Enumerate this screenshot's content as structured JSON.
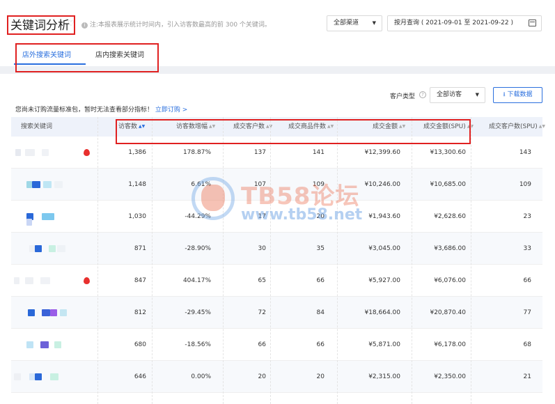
{
  "header": {
    "title": "关键词分析",
    "heart_icon": "heart-outline-icon",
    "note_icon": "info-icon",
    "note": "注:本报表展示统计时间内，引入访客数最高的前 300 个关键词。",
    "channel": "全部渠道",
    "date_mode": "按月查询",
    "date_range": "( 2021-09-01 至 2021-09-22 )",
    "calendar_icon": "calendar-icon"
  },
  "tabs": [
    {
      "label": "店外搜索关键词",
      "active": true
    },
    {
      "label": "店内搜索关键词",
      "active": false
    }
  ],
  "toolbar": {
    "customer_type_label": "客户类型",
    "help_icon": "question-icon",
    "customer_type_value": "全部访客",
    "download_label": "下载数据",
    "download_icon": "download-icon"
  },
  "notice": {
    "text": "您尚未订购流量标准包，暂时无法查看部分指标！",
    "link": "立即订购 >"
  },
  "table": {
    "columns": [
      "搜索关键词",
      "访客数",
      "访客数增幅",
      "成交客户数",
      "成交商品件数",
      "成交金额",
      "成交金额(SPU)",
      "成交客户数(SPU)"
    ],
    "rows": [
      [
        "",
        "1,386",
        "178.87%",
        "137",
        "141",
        "¥12,399.60",
        "¥13,300.60",
        "143"
      ],
      [
        "",
        "1,148",
        "6.61%",
        "107",
        "109",
        "¥10,246.00",
        "¥10,685.00",
        "109"
      ],
      [
        "",
        "1,030",
        "-44.29%",
        "17",
        "20",
        "¥1,943.60",
        "¥2,628.60",
        "23"
      ],
      [
        "",
        "871",
        "-28.90%",
        "30",
        "35",
        "¥3,045.00",
        "¥3,686.00",
        "33"
      ],
      [
        "",
        "847",
        "404.17%",
        "65",
        "66",
        "¥5,927.00",
        "¥6,076.00",
        "66"
      ],
      [
        "",
        "812",
        "-29.45%",
        "72",
        "84",
        "¥18,664.00",
        "¥20,870.40",
        "77"
      ],
      [
        "",
        "680",
        "-18.56%",
        "66",
        "66",
        "¥5,871.00",
        "¥6,178.00",
        "68"
      ],
      [
        "",
        "646",
        "0.00%",
        "20",
        "20",
        "¥2,315.00",
        "¥2,350.00",
        "21"
      ]
    ]
  },
  "watermark": {
    "title": "TB58论坛",
    "url": "www.tb58.net"
  },
  "colors": {
    "accent": "#2a6fde",
    "highlight_box": "#e02020",
    "hot_icon": "#e8302e"
  }
}
